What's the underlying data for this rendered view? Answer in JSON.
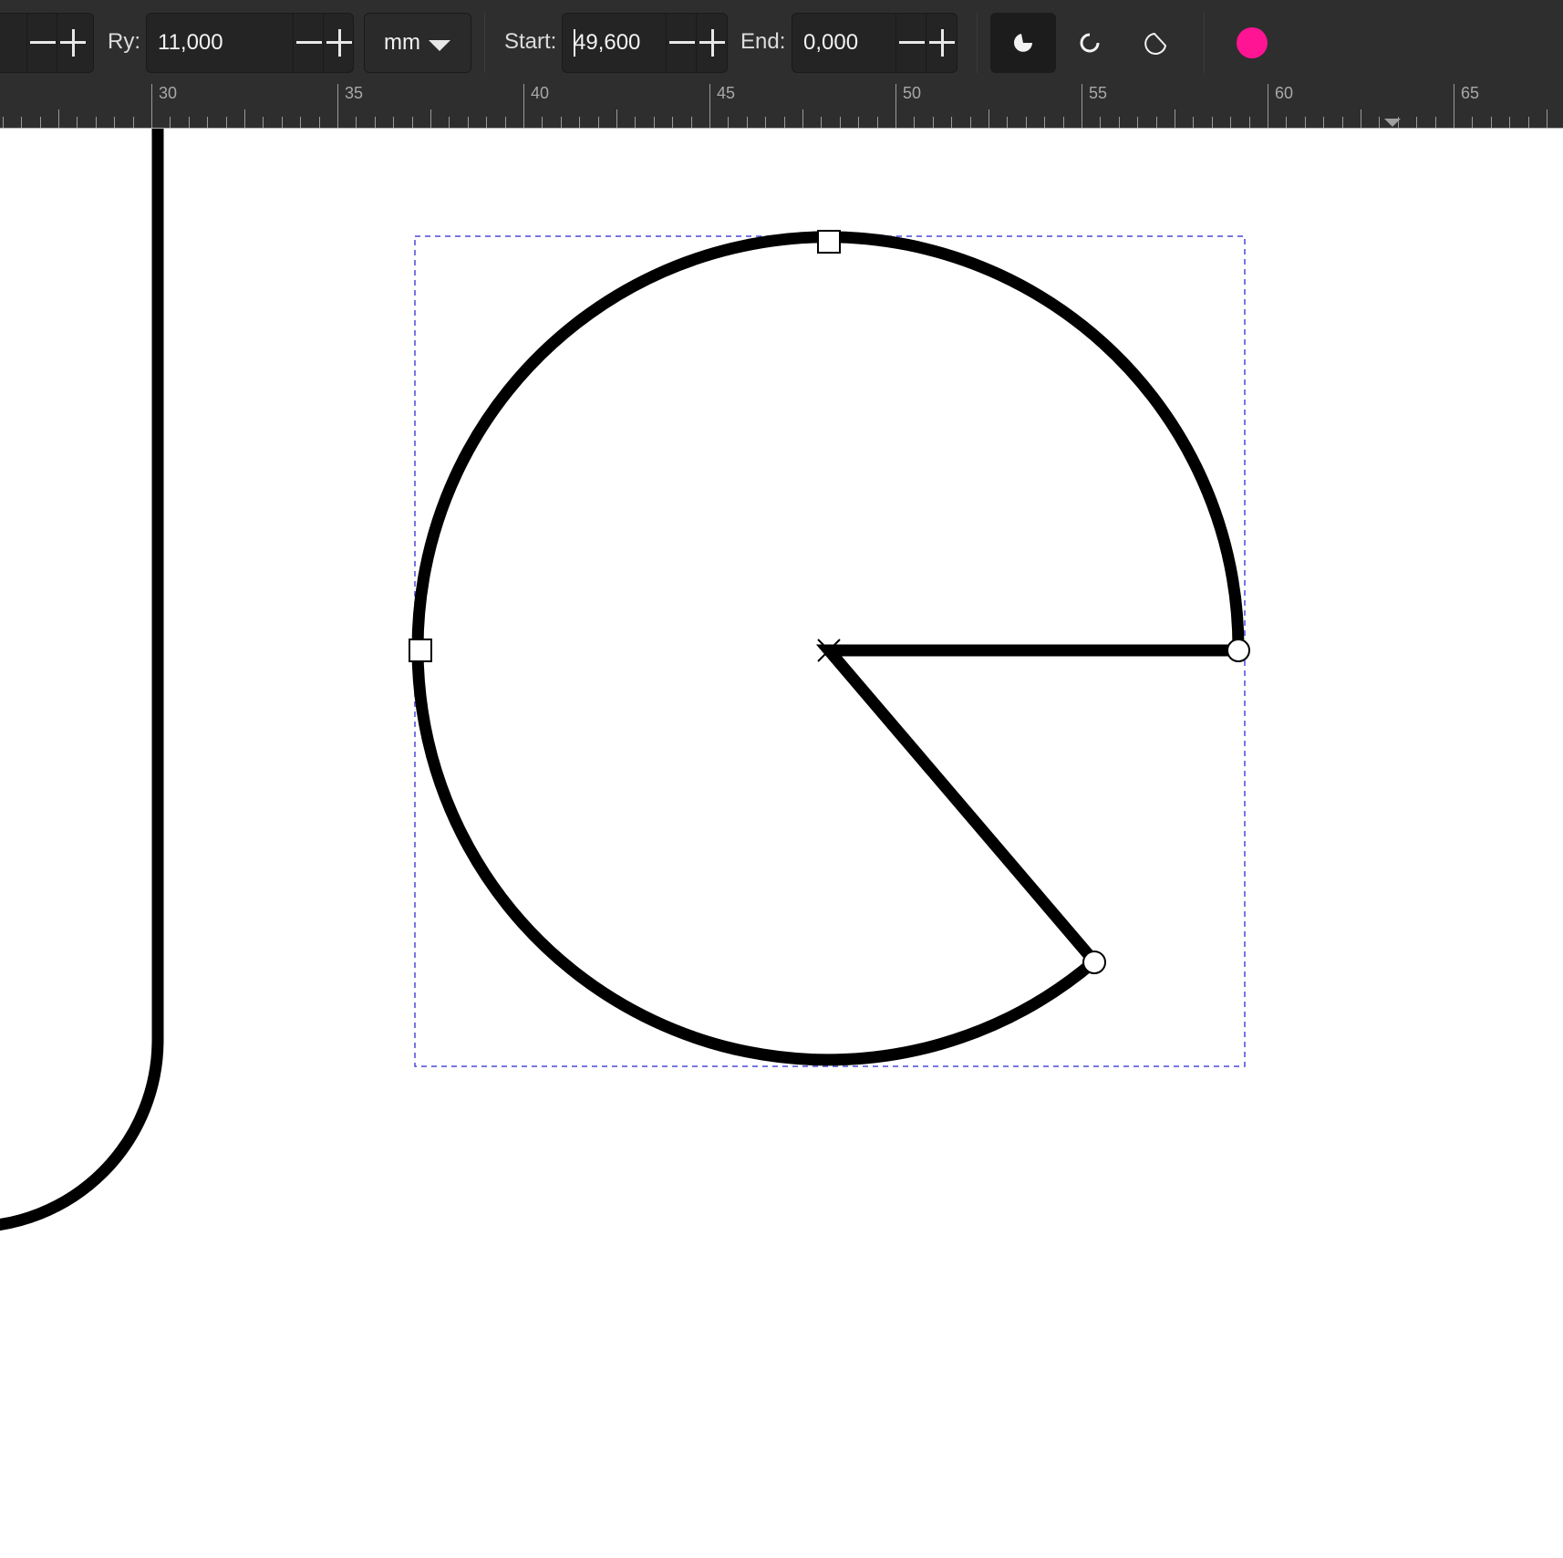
{
  "toolbar": {
    "rx_controls": {
      "minus": "decrement",
      "plus": "increment"
    },
    "ry": {
      "label": "Ry:",
      "value": "11,000"
    },
    "unit": {
      "value": "mm"
    },
    "start": {
      "label": "Start:",
      "value": "49,600"
    },
    "end": {
      "label": "End:",
      "value": "0,000"
    },
    "arc_types": [
      {
        "name": "slice",
        "icon": "pie-slice-icon",
        "active": true
      },
      {
        "name": "arc",
        "icon": "open-arc-icon",
        "active": false
      },
      {
        "name": "chord",
        "icon": "chord-icon",
        "active": false
      }
    ],
    "color": {
      "icon": "color-swatch-icon",
      "hex": "#ff1493"
    }
  },
  "ruler": {
    "labels": [
      "30",
      "35",
      "40",
      "45",
      "50",
      "55",
      "60",
      "65"
    ]
  },
  "canvas": {
    "shape": "ellipse-slice",
    "start_angle": "49,600",
    "end_angle": "0,000"
  }
}
